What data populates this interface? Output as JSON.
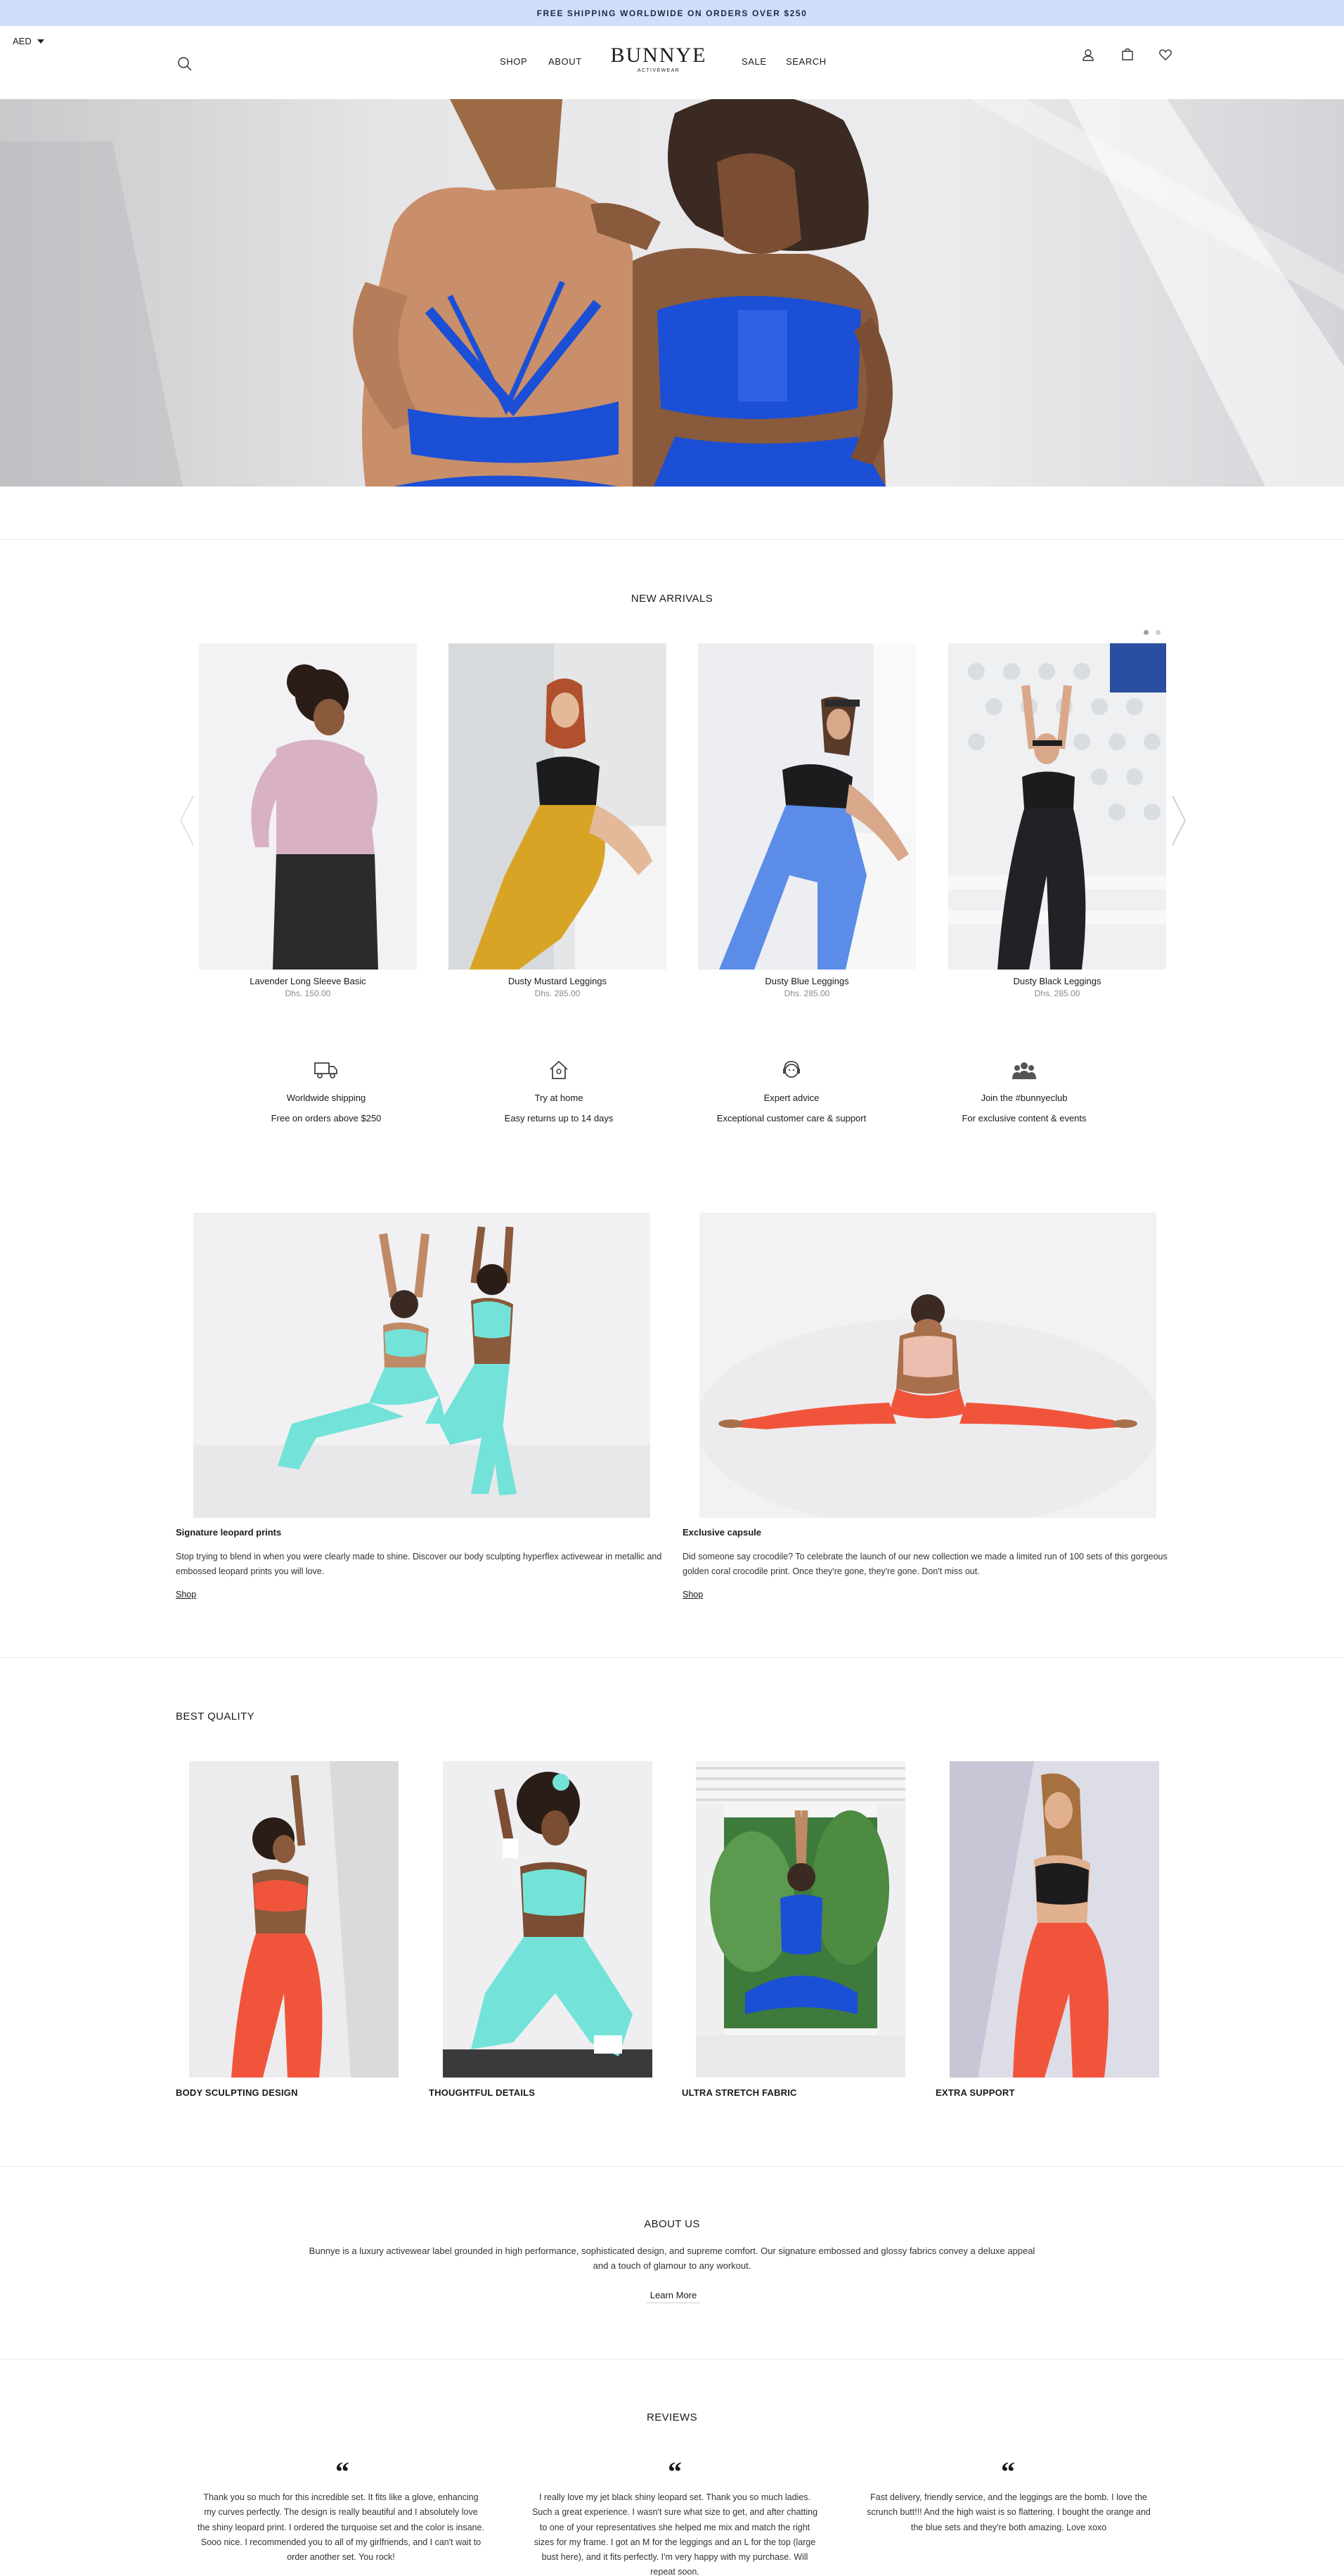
{
  "announcement": "FREE SHIPPING WORLDWIDE ON ORDERS OVER $250",
  "header": {
    "currency": "AED",
    "nav_left": [
      "SHOP",
      "ABOUT"
    ],
    "nav_right": [
      "SALE",
      "SEARCH"
    ],
    "logo": "BUNNYE",
    "logo_sub": "ACTIVEWEAR",
    "icons": [
      "search-icon",
      "account-icon",
      "cart-icon",
      "wishlist-icon"
    ]
  },
  "new_arrivals": {
    "title": "NEW ARRIVALS",
    "products": [
      {
        "name": "Lavender Long Sleeve Basic",
        "price": "Dhs. 150.00"
      },
      {
        "name": "Dusty Mustard Leggings",
        "price": "Dhs. 285.00"
      },
      {
        "name": "Dusty Blue Leggings",
        "price": "Dhs. 285.00"
      },
      {
        "name": "Dusty Black Leggings",
        "price": "Dhs. 285.00"
      }
    ]
  },
  "features": [
    {
      "icon": "truck-icon",
      "title": "Worldwide shipping",
      "sub": "Free on orders above $250"
    },
    {
      "icon": "home-icon",
      "title": "Try at home",
      "sub": "Easy returns up to 14 days"
    },
    {
      "icon": "support-agent-icon",
      "title": "Expert advice",
      "sub": "Exceptional customer care & support"
    },
    {
      "icon": "community-icon",
      "title": "Join the #bunnyeclub",
      "sub": "For exclusive content & events"
    }
  ],
  "promos": [
    {
      "title": "Signature leopard prints",
      "body": "Stop trying to blend in when you were clearly made to shine. Discover our body sculpting hyperflex activewear in metallic and embossed leopard prints you will love.",
      "link": "Shop"
    },
    {
      "title": "Exclusive capsule",
      "body": "Did someone say crocodile? To celebrate the launch of our new collection we made a limited run of 100 sets of this gorgeous golden coral crocodile print. Once they're gone, they're gone. Don't miss out.",
      "link": "Shop"
    }
  ],
  "best_quality": {
    "title": "BEST QUALITY",
    "items": [
      "BODY SCULPTING DESIGN",
      "THOUGHTFUL DETAILS",
      "ULTRA STRETCH FABRIC",
      "EXTRA SUPPORT"
    ]
  },
  "about": {
    "title": "ABOUT US",
    "body": "Bunnye is a luxury activewear label grounded in high performance, sophisticated design, and supreme comfort. Our signature embossed and glossy fabrics convey a deluxe appeal and a touch of glamour to any workout.",
    "button": "Learn More"
  },
  "reviews": {
    "title": "REVIEWS",
    "quote_mark": "“",
    "items": [
      "Thank you so much for this incredible set. It fits like a glove, enhancing my curves perfectly. The design is really beautiful and I absolutely love the shiny leopard print. I ordered the turquoise set and the color is insane. Sooo nice. I recommended you to all of my girlfriends, and I can't wait to order another set. You rock!",
      "I really love my jet black shiny leopard set. Thank you so much ladies. Such a great experience. I wasn't sure what size to get, and after chatting to one of your representatives she helped me mix and match the right sizes for my frame. I got an M for the leggings and an L for the top (large bust here), and it fits perfectly. I'm very happy with my purchase. Will repeat soon.",
      "Fast delivery, friendly service, and the leggings are the bomb. I love the scrunch butt!!! And the high waist is so flattering. I bought the orange and the blue sets and they're both amazing. Love xoxo"
    ]
  },
  "colors": {
    "announce_bg": "#cfdff9",
    "royal_blue": "#1a4fd6",
    "turquoise": "#73e3d9",
    "coral": "#f0553c"
  }
}
